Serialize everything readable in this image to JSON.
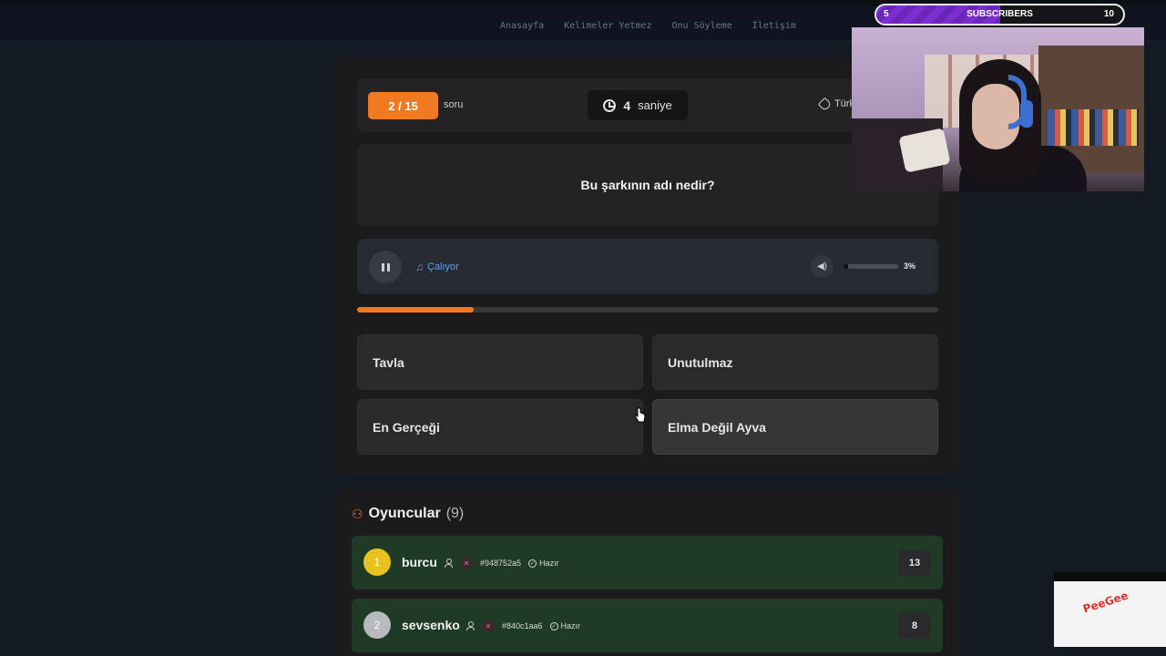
{
  "nav": {
    "links": [
      "Anasayfa",
      "Kelimeler Yetmez",
      "Onu Söyleme",
      "İletişim"
    ]
  },
  "quiz": {
    "progress_label": "2 / 15",
    "progress_unit": "soru",
    "timer_value": "4",
    "timer_unit": "saniye",
    "category": "Türk",
    "question": "Bu şarkının adı nedir?",
    "player_status": "Çalıyor",
    "volume_percent": "3%",
    "volume_level": 0.03,
    "song_progress": 0.2,
    "options": [
      "Tavla",
      "Unutulmaz",
      "En Gerçeği",
      "Elma Değil Ayva"
    ]
  },
  "players": {
    "title": "Oyuncular",
    "count": "(9)",
    "list": [
      {
        "rank": "1",
        "name": "burcu",
        "id": "#948752a5",
        "status": "Hazır",
        "score": "13"
      },
      {
        "rank": "2",
        "name": "sevsenko",
        "id": "#840c1aa6",
        "status": "Hazır",
        "score": "8"
      }
    ]
  },
  "overlay": {
    "sub_current": "5",
    "sub_label": "SUBSCRIBERS",
    "sub_goal": "10",
    "sub_progress": 0.5,
    "corner_logo": "PeeGee"
  },
  "colors": {
    "accent": "#f07a22",
    "player_row": "#1f3b25",
    "link": "#5aa4f0"
  }
}
